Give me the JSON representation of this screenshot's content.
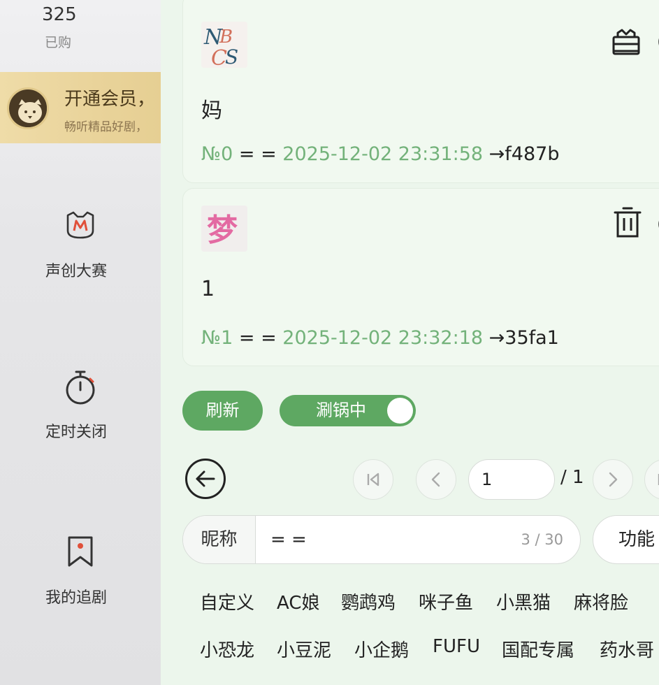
{
  "sidebar": {
    "stat_value": "325",
    "stat_label": "已购",
    "vip_title": "开通会员，",
    "vip_subtitle": "畅听精品好剧，",
    "items": [
      {
        "label": "声创大赛",
        "icon": "cat-m-icon"
      },
      {
        "label": "定时关闭",
        "icon": "timer-icon"
      },
      {
        "label": "我的追剧",
        "icon": "bookmark-icon"
      }
    ]
  },
  "messages": [
    {
      "avatar": "nbcs-logo",
      "text": "妈",
      "index": "№0",
      "sender": "= =",
      "time": "2025-12-02 23:31:58",
      "hash": "→f487b",
      "action_icon": "gift-icon"
    },
    {
      "avatar": "meng-logo",
      "text": "1",
      "index": "№1",
      "sender": "= =",
      "time": "2025-12-02 23:32:18",
      "hash": "→35fa1",
      "action_icon": "trash-icon"
    }
  ],
  "controls": {
    "refresh_label": "刷新",
    "toggle_label": "涮锅中",
    "toggle_on": true
  },
  "pagination": {
    "current": "1",
    "total": "/ 1"
  },
  "nickname": {
    "label": "昵称",
    "value": "= =",
    "count": "3 / 30",
    "function_label": "功能"
  },
  "voices": {
    "row1": [
      "自定义",
      "AC娘",
      "鹦鹉鸡",
      "咪子鱼",
      "小黑猫",
      "麻将脸"
    ],
    "row2": [
      "小恐龙",
      "小豆泥",
      "小企鹅",
      "FUFU",
      "国配专属",
      "药水哥"
    ]
  },
  "colors": {
    "accent": "#5ea862",
    "meta_green": "#73b27a",
    "panel_bg": "#ecf6ec",
    "vip_gold": "#e9d39a"
  }
}
